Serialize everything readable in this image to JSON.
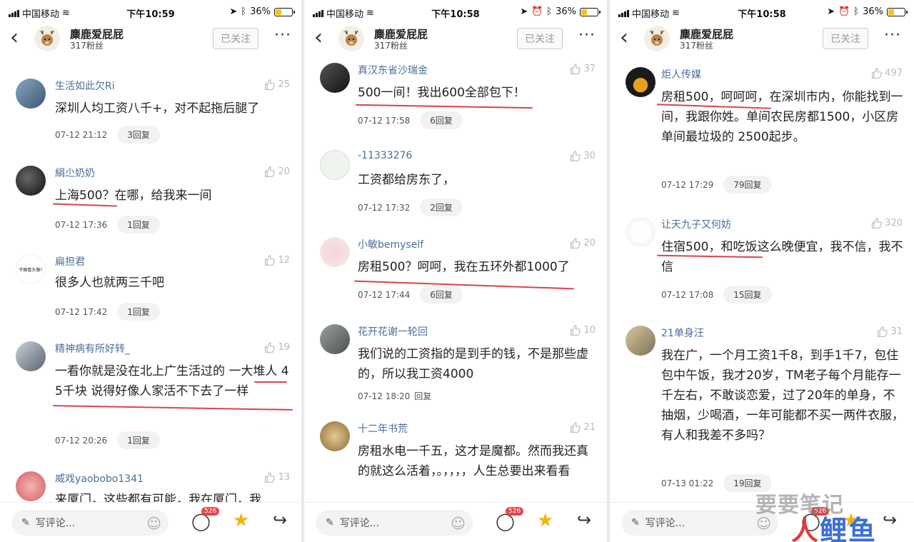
{
  "panels": [
    {
      "status": {
        "carrier": "中国移动",
        "time": "下午10:59",
        "battery": "36%"
      },
      "header": {
        "name": "麋鹿爱屁屁",
        "fans": "317粉丝",
        "follow": "已关注"
      },
      "comments": [
        {
          "user": "生活如此欠Ri",
          "likes": "25",
          "text": "深圳人均工资八千+，对不起拖后腿了",
          "time": "07-12 21:12",
          "reply": "3回复"
        },
        {
          "user": "絹尐奶奶",
          "likes": "20",
          "text": "上海500？在哪，给我来一间",
          "time": "07-12 17:36",
          "reply": "1回复"
        },
        {
          "user": "扁担君",
          "likes": "12",
          "text": "很多人也就两三千吧",
          "time": "07-12 17:42",
          "reply": "1回复",
          "avatar_text": "干嘛看头像?"
        },
        {
          "user": "精神病有所好转_",
          "likes": "19",
          "text": "一看你就是没在北上广生活过的  一大堆人 4 5千块  说得好像人家活不下去了一样",
          "time": "07-12 20:26",
          "reply": "1回复"
        },
        {
          "user": "威戏yaobobo1341",
          "likes": "13",
          "text": "来厦门，这些都有可能，我在厦门，我",
          "time": "",
          "reply": ""
        }
      ],
      "bottom": {
        "placeholder": "写评论...",
        "count": "526"
      }
    },
    {
      "status": {
        "carrier": "中国移动",
        "time": "下午10:58",
        "battery": "36%"
      },
      "header": {
        "name": "麋鹿爱屁屁",
        "fans": "317粉丝",
        "follow": "已关注"
      },
      "comments": [
        {
          "user": "真汉东省沙瑞金",
          "likes": "37",
          "text": "500一间！我出600全部包下！",
          "time": "07-12 17:58",
          "reply": "6回复"
        },
        {
          "user": "-11333276",
          "likes": "30",
          "text": "工资都给房东了，",
          "time": "07-12 17:32",
          "reply": "2回复"
        },
        {
          "user": "小敏bemyself",
          "likes": "20",
          "text": "房租500？呵呵，我在五环外都1000了",
          "time": "07-12 17:44",
          "reply": "6回复"
        },
        {
          "user": "花开花谢一轮回",
          "likes": "10",
          "text": "我们说的工资指的是到手的钱，不是那些虚的，所以我工资4000",
          "time": "07-12 18:20",
          "reply": "回复"
        },
        {
          "user": "十二年书荒",
          "likes": "21",
          "text": "房租水电一千五，这才是魔都。然而我还真的就这么活着，。，，，，人生总要出来看看",
          "time": "",
          "reply": ""
        }
      ],
      "bottom": {
        "placeholder": "写评论...",
        "count": "526"
      }
    },
    {
      "status": {
        "carrier": "中国移动",
        "time": "下午10:58",
        "battery": "36%"
      },
      "header": {
        "name": "麋鹿爱屁屁",
        "fans": "317粉丝",
        "follow": "已关注"
      },
      "comments": [
        {
          "user": "炬人传媒",
          "likes": "497",
          "text": "房租500，呵呵呵，在深圳市内，你能找到一间，我跟你姓。单间农民房都1500，小区房单间最垃圾的 2500起步。",
          "time": "07-12 17:29",
          "reply": "79回复"
        },
        {
          "user": "让天九子又何妨",
          "likes": "320",
          "text": "住宿500，和吃饭这么晚便宜，我不信，我不信",
          "time": "07-12 17:08",
          "reply": "15回复"
        },
        {
          "user": "21单身汪",
          "likes": "31",
          "text": "我在广，一个月工资1千8，到手1千7，包住包中午饭，我才20岁，TM老子每个月能存一千左右，不敢谈恋爱，过了20年的单身，不抽烟，少喝酒，一年可能都不买一两件衣服，有人和我差不多吗？",
          "time": "07-13 01:22",
          "reply": "19回复"
        }
      ],
      "bottom": {
        "placeholder": "写评论...",
        "count": "526"
      }
    }
  ],
  "watermark": {
    "line1": "要要笔记",
    "line2_red": "人",
    "line2_blue": "鲤鱼"
  },
  "colors": {
    "username": "#4a6d99",
    "underline": "#d9454b",
    "star": "#f5b10a",
    "badge": "#e6454b"
  }
}
